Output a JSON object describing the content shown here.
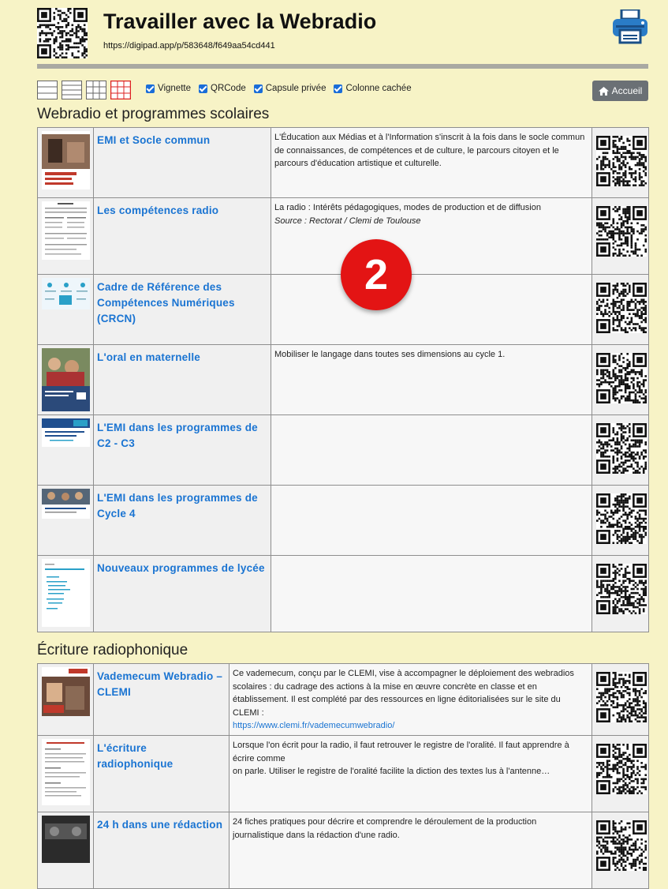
{
  "header": {
    "title": "Travailler avec la Webradio",
    "url": "https://digipad.app/p/583648/f649aa54cd441"
  },
  "toolbar": {
    "checkboxes": [
      {
        "label": "Vignette",
        "checked": true
      },
      {
        "label": "QRCode",
        "checked": true
      },
      {
        "label": "Capsule privée",
        "checked": true
      },
      {
        "label": "Colonne cachée",
        "checked": true
      }
    ],
    "home_label": "Accueil"
  },
  "badge": "2",
  "colors": {
    "link": "#1a74d2",
    "badge": "#e31414",
    "background": "#f7f3c6"
  },
  "sections": [
    {
      "title": "Webradio et programmes scolaires",
      "rows": [
        {
          "title": "EMI et Socle commun",
          "desc": "L'Éducation aux Médias et à l'Information s'inscrit à la fois dans le socle commun de connaissances, de compétences et de culture, le parcours citoyen et le parcours d'éducation artistique et culturelle."
        },
        {
          "title": "Les compétences radio",
          "desc": "La radio : Intérêts pédagogiques, modes de production et de diffusion",
          "source": "Source : Rectorat / Clemi de Toulouse"
        },
        {
          "title": "Cadre de Référence des Compétences Numériques (CRCN)",
          "desc": ""
        },
        {
          "title": "L'oral en maternelle",
          "desc": "Mobiliser le langage dans toutes ses dimensions au cycle 1."
        },
        {
          "title": "L'EMI dans les programmes de C2 - C3",
          "desc": ""
        },
        {
          "title": "L'EMI dans les programmes de Cycle 4",
          "desc": ""
        },
        {
          "title": "Nouveaux programmes de lycée",
          "desc": ""
        }
      ]
    },
    {
      "title": "Écriture radiophonique",
      "rows": [
        {
          "title": "Vademecum Webradio – CLEMI",
          "desc": "Ce vademecum, conçu par le CLEMI, vise à accompagner le déploiement des webradios scolaires : du cadrage des actions à la mise en œuvre concrète en classe et en établissement. Il est complété par des ressources en ligne éditorialisées sur le site du CLEMI :",
          "link": "https://www.clemi.fr/vademecumwebradio/"
        },
        {
          "title": "L'écriture radiophonique",
          "desc": "Lorsque l'on écrit pour la radio, il faut retrouver le registre de l'oralité. Il faut apprendre à écrire comme",
          "desc2": "on parle. Utiliser le registre de l'oralité facilite la diction des textes lus à l'antenne…"
        },
        {
          "title": "24 h dans une rédaction",
          "desc": "24 fiches pratiques pour décrire et comprendre le déroulement de la production journalistique dans la rédaction d'une radio."
        }
      ]
    }
  ]
}
